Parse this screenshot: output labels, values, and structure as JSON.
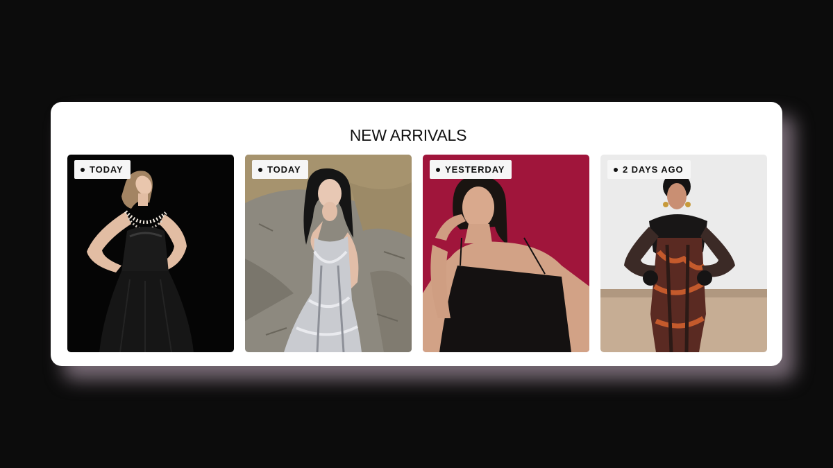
{
  "section": {
    "title": "NEW ARRIVALS"
  },
  "products": [
    {
      "badge": "TODAY",
      "image": "model-black-gown-photo",
      "background": "#060606"
    },
    {
      "badge": "TODAY",
      "image": "model-silver-sequin-dress-photo",
      "background": "#8e8a80"
    },
    {
      "badge": "YESTERDAY",
      "image": "model-black-slip-dress-photo",
      "background": "#a0153b"
    },
    {
      "badge": "2 DAYS AGO",
      "image": "model-feather-trim-dress-photo",
      "background": "#e9e9e9"
    }
  ]
}
